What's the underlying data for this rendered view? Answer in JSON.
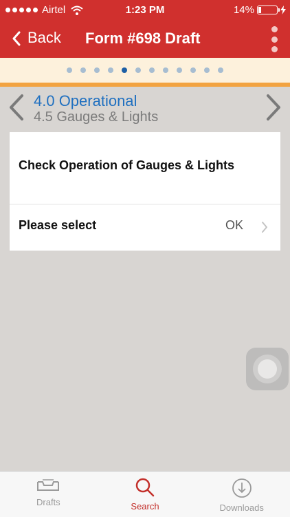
{
  "status_bar": {
    "carrier": "Airtel",
    "time": "1:23 PM",
    "battery_percent": "14%",
    "battery_level": 0.14
  },
  "nav": {
    "back_label": "Back",
    "title": "Form #698 Draft"
  },
  "page_indicator": {
    "count": 12,
    "active_index": 4
  },
  "section": {
    "title": "4.0 Operational",
    "subtitle": "4.5 Gauges & Lights"
  },
  "question": {
    "text": "Check Operation of Gauges & Lights",
    "select_label": "Please select",
    "selected_value": "OK"
  },
  "tabs": [
    {
      "label": "Drafts",
      "icon": "tray-icon",
      "active": false
    },
    {
      "label": "Search",
      "icon": "search-icon",
      "active": true
    },
    {
      "label": "Downloads",
      "icon": "download-icon",
      "active": false
    }
  ],
  "colors": {
    "brand": "#d0302e",
    "accent_blue": "#2070c0",
    "indicator_active": "#1d5fa5",
    "tab_active": "#c3302b"
  }
}
